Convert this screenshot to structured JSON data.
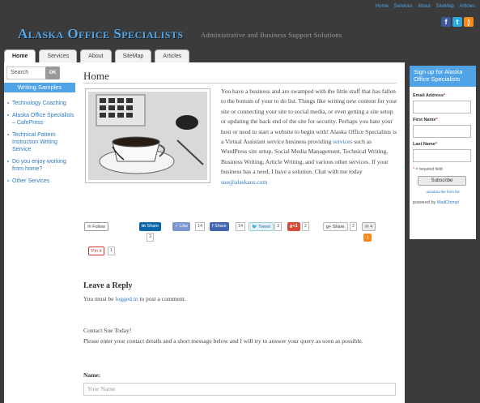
{
  "colors": {
    "accent": "#4fa3e6",
    "link": "#2c78c4",
    "background": "#3b3b3b"
  },
  "header": {
    "top_links": [
      "Home",
      "Services",
      "About",
      "SiteMap",
      "Articles"
    ],
    "social_icons": [
      "facebook-icon",
      "twitter-icon",
      "rss-icon"
    ],
    "brand": "Alaska Office Specialists",
    "tagline": "Administrative and Business Support Solutions"
  },
  "tabs": [
    "Home",
    "Services",
    "About",
    "SiteMap",
    "Articles"
  ],
  "active_tab": "Home",
  "left_sidebar": {
    "search_placeholder": "Search",
    "search_button": "OK",
    "heading": "Writing Samples",
    "items": [
      "Technology Coaching",
      "Alaska Office Specialists – CafePress",
      "Technical Pattern Instruction Writing Service",
      "Do you enjoy working from home?",
      "Other Services"
    ]
  },
  "main": {
    "title": "Home",
    "para_1": "You have a business and are swamped with the little stuff that has fallen to the bottom of your to do list. Things like writing new content for your site or connecting your site to social media, or even getting a site setup or updating the back end of the site for security. Perhaps you hate your host or need to start a website to begin with! Alaska Office Specialists is a Virtual Assistant service business providing ",
    "services_link": "services",
    "para_2": " such as WordPress site setup, Social Media Management, Technical Writing, Business Writing, Article Writing, and various other services. If your business has a need, I have a solution. Chat with me today ",
    "email": "sue@alaskaos.com"
  },
  "share": {
    "follow": "Follow",
    "linkedin": "Share",
    "linkedin_count": "3",
    "like": "Like",
    "like_count": "14",
    "fb_share": "Share",
    "fb_count": "14",
    "tweet": "Tweet",
    "tweet_count": "3",
    "gplus": "+1",
    "gplus_count": "2",
    "gshare": "Share",
    "gshare_count": "2",
    "email_count": "4",
    "pinit": "Pin it",
    "pinit_count": "1"
  },
  "comments": {
    "heading": "Leave a Reply",
    "must_be": "You must be ",
    "logged_in": "logged in",
    "to_post": " to post a comment.",
    "contact_title": "Contact Sue Today!",
    "contact_text": "Please enter your contact details and a short message below and I will try to answer your query as soon as possible.",
    "name_label": "Name:",
    "name_placeholder": "Your Name"
  },
  "signup": {
    "heading": "Sign up for Alaska Office Specialists",
    "email_label": "Email Address",
    "first_label": "First Name",
    "last_label": "Last Name",
    "required_note": "= required field",
    "subscribe": "Subscribe",
    "unsubscribe": "unsubscribe from list",
    "powered": "powered by ",
    "mailchimp": "MailChimp!"
  }
}
